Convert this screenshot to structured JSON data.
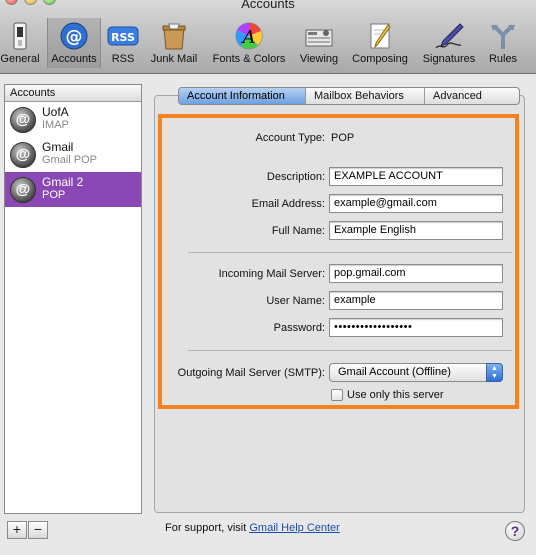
{
  "window": {
    "title": "Accounts"
  },
  "toolbar": [
    {
      "label": "General",
      "icon": "switch-icon"
    },
    {
      "label": "Accounts",
      "icon": "at-sign-icon",
      "selected": true
    },
    {
      "label": "RSS",
      "icon": "rss-icon"
    },
    {
      "label": "Junk Mail",
      "icon": "junk-mail-icon"
    },
    {
      "label": "Fonts & Colors",
      "icon": "fonts-colors-icon"
    },
    {
      "label": "Viewing",
      "icon": "viewing-icon"
    },
    {
      "label": "Composing",
      "icon": "composing-icon"
    },
    {
      "label": "Signatures",
      "icon": "signatures-icon"
    },
    {
      "label": "Rules",
      "icon": "rules-icon"
    }
  ],
  "accounts": {
    "header": "Accounts",
    "items": [
      {
        "name": "UofA",
        "type": "IMAP"
      },
      {
        "name": "Gmail",
        "type": "Gmail POP"
      },
      {
        "name": "Gmail 2",
        "type": "POP",
        "selected": true
      }
    ],
    "add_label": "+",
    "remove_label": "−"
  },
  "tabs": [
    {
      "label": "Account Information",
      "active": true
    },
    {
      "label": "Mailbox Behaviors"
    },
    {
      "label": "Advanced"
    }
  ],
  "form": {
    "account_type_label": "Account Type:",
    "account_type_value": "POP",
    "description_label": "Description:",
    "description_value": "EXAMPLE ACCOUNT",
    "email_label": "Email Address:",
    "email_value": "example@gmail.com",
    "fullname_label": "Full Name:",
    "fullname_value": "Example English",
    "incoming_label": "Incoming Mail Server:",
    "incoming_value": "pop.gmail.com",
    "username_label": "User Name:",
    "username_value": "example",
    "password_label": "Password:",
    "password_value": "••••••••••••••••••",
    "smtp_label": "Outgoing Mail Server (SMTP):",
    "smtp_value": "Gmail Account (Offline)",
    "only_server_label": "Use only this server"
  },
  "footer": {
    "support_text": "For support, visit ",
    "support_link": "Gmail Help Center",
    "help_label": "?"
  },
  "colors": {
    "highlight": "#f58220",
    "selection": "#8a48b5",
    "tab_active": "#6fa0e0"
  }
}
